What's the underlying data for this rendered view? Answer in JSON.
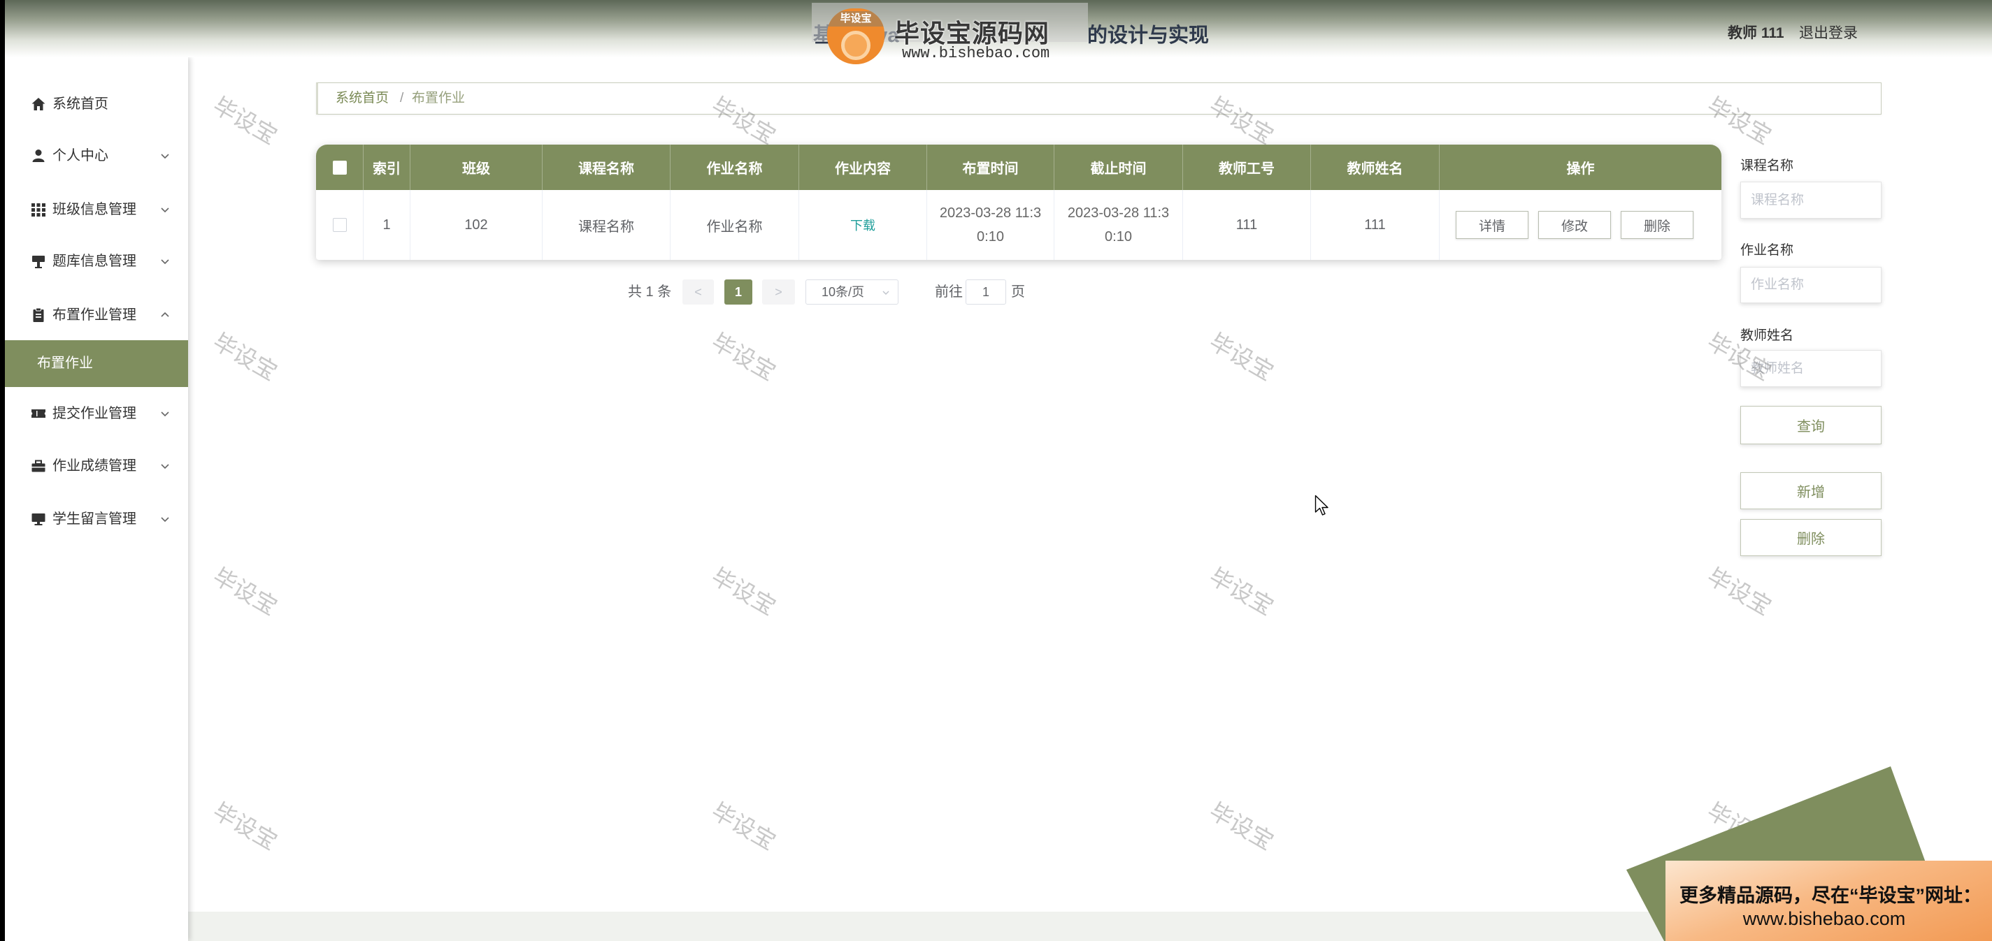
{
  "header": {
    "title_left": "基于Java",
    "title_right": "的设计与实现",
    "watermark_logo": {
      "badge": "毕设宝",
      "name": "毕设宝源码网",
      "url": "www.bishebao.com"
    },
    "user_label": "教师 111",
    "logout": "退出登录"
  },
  "sidebar": {
    "items": [
      {
        "label": "系统首页",
        "icon": "home-icon"
      },
      {
        "label": "个人中心",
        "icon": "user-icon",
        "expanded": false
      },
      {
        "label": "班级信息管理",
        "icon": "grid-icon",
        "expanded": false
      },
      {
        "label": "题库信息管理",
        "icon": "easel-icon",
        "expanded": false
      },
      {
        "label": "布置作业管理",
        "icon": "clipboard-icon",
        "expanded": true,
        "children": [
          {
            "label": "布置作业",
            "active": true
          }
        ]
      },
      {
        "label": "提交作业管理",
        "icon": "ticket-icon",
        "expanded": false
      },
      {
        "label": "作业成绩管理",
        "icon": "briefcase-icon",
        "expanded": false
      },
      {
        "label": "学生留言管理",
        "icon": "monitor-icon",
        "expanded": false
      }
    ]
  },
  "breadcrumb": {
    "home": "系统首页",
    "separator": "/",
    "current": "布置作业"
  },
  "table": {
    "columns": [
      "索引",
      "班级",
      "课程名称",
      "作业名称",
      "作业内容",
      "布置时间",
      "截止时间",
      "教师工号",
      "教师姓名",
      "操作"
    ],
    "rows": [
      {
        "index": "1",
        "class": "102",
        "course": "课程名称",
        "homework": "作业名称",
        "content": "下载",
        "assigned_time": "2023-03-28 11:30:10",
        "deadline": "2023-03-28 11:30:10",
        "teacher_id": "111",
        "teacher_name": "111"
      }
    ],
    "row_actions": [
      "详情",
      "修改",
      "删除"
    ]
  },
  "pagination": {
    "total_text": "共 1 条",
    "prev": "<",
    "current_page": "1",
    "next": ">",
    "page_size": "10条/页",
    "goto_label": "前往",
    "goto_value": "1",
    "page_unit": "页"
  },
  "search": {
    "fields": [
      {
        "label": "课程名称",
        "placeholder": "课程名称"
      },
      {
        "label": "作业名称",
        "placeholder": "作业名称"
      },
      {
        "label": "教师姓名",
        "placeholder": "教师姓名"
      }
    ],
    "query_button": "查询",
    "add_button": "新增",
    "delete_button": "删除"
  },
  "watermark_text": "毕设宝",
  "ad_banner": {
    "line1": "更多精品源码，尽在“毕设宝”网址：",
    "line2": "www.bishebao.com"
  },
  "colors": {
    "accent": "#7f8e5e",
    "link": "#1f9e9a",
    "ad_orange": "#f29a54",
    "text": "#606266"
  }
}
